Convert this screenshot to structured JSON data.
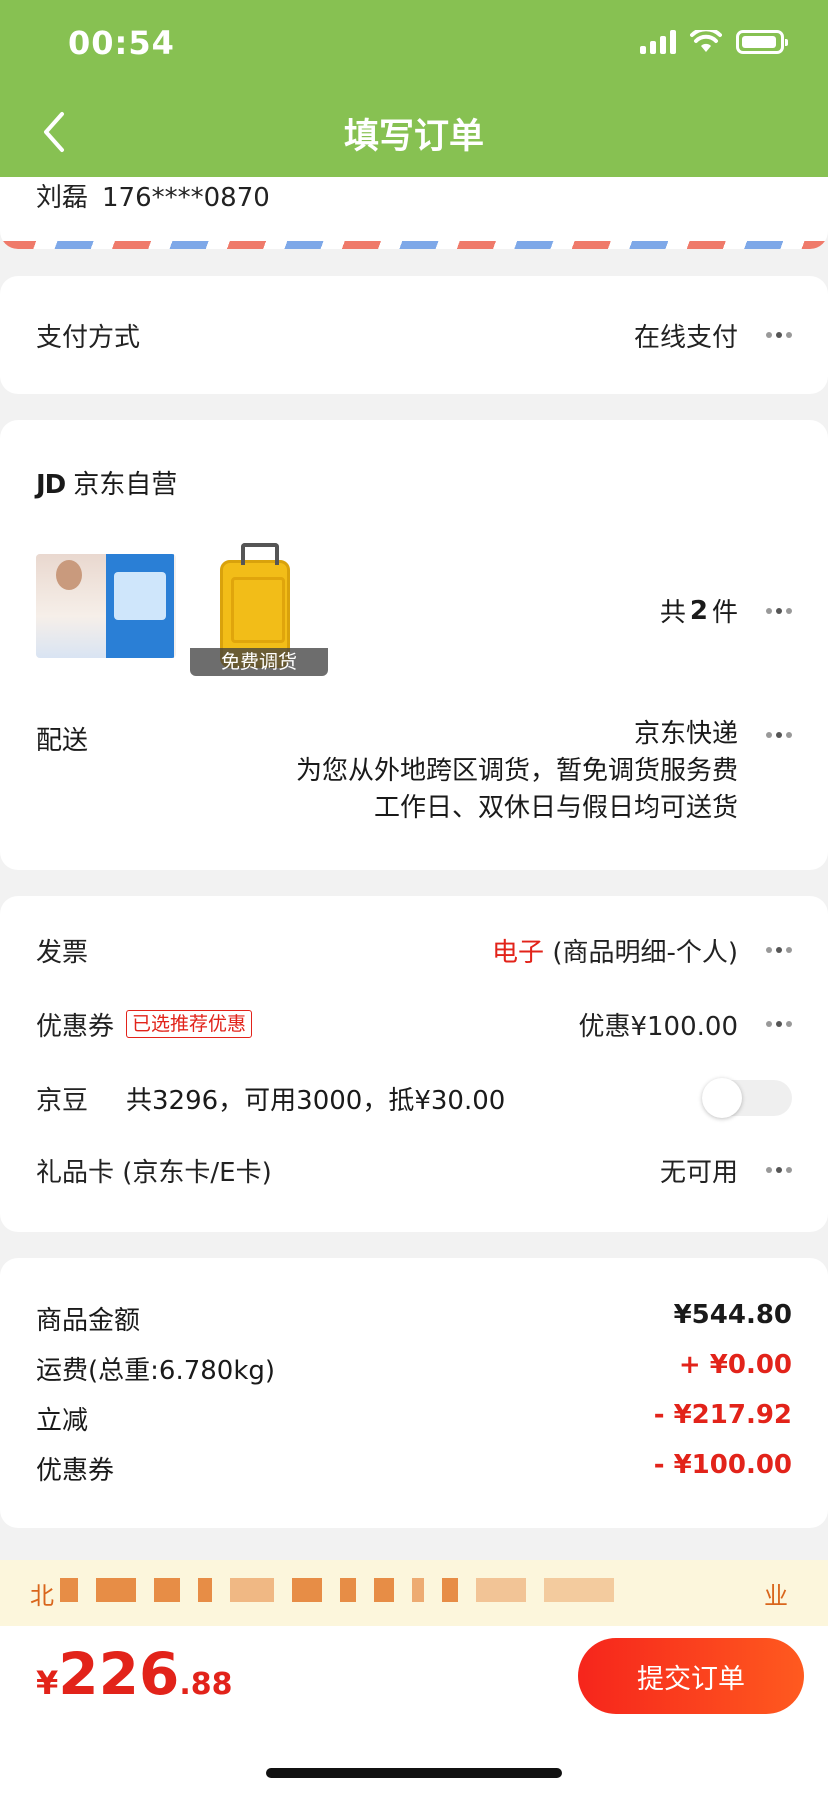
{
  "status_bar": {
    "time": "00:54"
  },
  "nav": {
    "title": "填写订单"
  },
  "address": {
    "name": "刘磊",
    "phone": "176****0870"
  },
  "payment": {
    "label": "支付方式",
    "value": "在线支付"
  },
  "shop": {
    "brand": "JD",
    "name": "京东自营",
    "items": [
      {
        "name": "travel-disposable-pack-product",
        "tag": ""
      },
      {
        "name": "yellow-suitcase-product",
        "tag": "免费调货"
      }
    ],
    "count_prefix": "共",
    "count": "2",
    "count_suffix": "件",
    "delivery_label": "配送",
    "delivery_method": "京东快递",
    "delivery_note1": "为您从外地跨区调货，暂免调货服务费",
    "delivery_note2": "工作日、双休日与假日均可送货"
  },
  "options": {
    "invoice_label": "发票",
    "invoice_type": "电子",
    "invoice_detail": "(商品明细-个人)",
    "coupon_label": "优惠券",
    "coupon_tag": "已选推荐优惠",
    "coupon_value": "优惠¥100.00",
    "jingdou_label": "京豆",
    "jingdou_info": "共3296，可用3000，抵¥30.00",
    "jingdou_enabled": false,
    "giftcard_label": "礼品卡 (京东卡/E卡)",
    "giftcard_value": "无可用"
  },
  "summary": [
    {
      "label": "商品金额",
      "amount": "¥544.80",
      "color": "#1a1a1a"
    },
    {
      "label": "运费(总重:6.780kg)",
      "amount": "+ ¥0.00",
      "color": "#e2231a"
    },
    {
      "label": "立减",
      "amount": "- ¥217.92",
      "color": "#e2231a"
    },
    {
      "label": "优惠券",
      "amount": "- ¥100.00",
      "color": "#e2231a"
    }
  ],
  "notice": {
    "text_start": "北",
    "text_end": "业"
  },
  "bottom": {
    "currency": "¥",
    "price_int": "226",
    "price_dec": ".88",
    "submit_label": "提交订单"
  },
  "colors": {
    "header_green": "#87c152",
    "accent_red": "#e2231a",
    "notice_orange": "#d9661c"
  }
}
